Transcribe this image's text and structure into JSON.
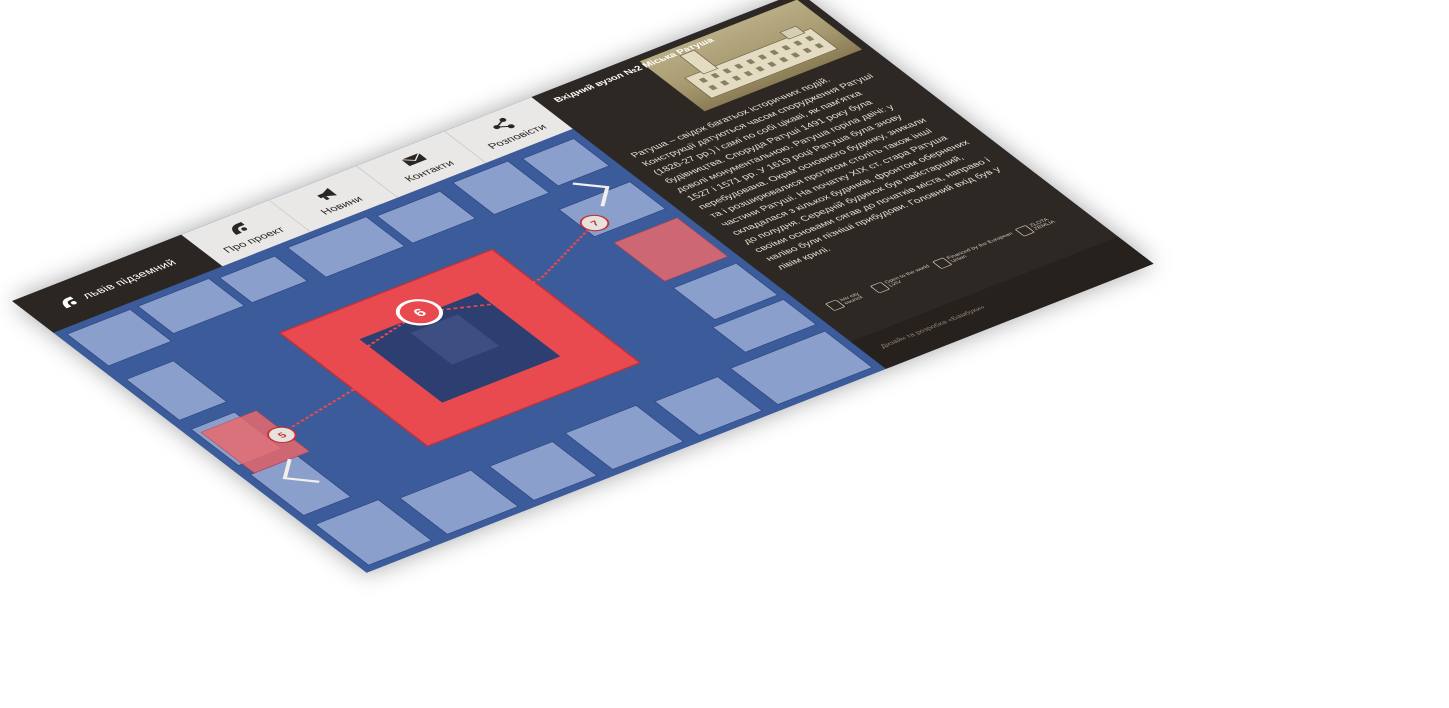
{
  "app": {
    "name": "львів підземний"
  },
  "nav": {
    "items": [
      {
        "label": "Про проект",
        "icon": "logo-mask-icon"
      },
      {
        "label": "Новини",
        "icon": "megaphone-icon"
      },
      {
        "label": "Контакти",
        "icon": "envelope-icon"
      },
      {
        "label": "Розповісти",
        "icon": "share-icon"
      }
    ]
  },
  "map": {
    "route_color": "#e84a4f",
    "building_highlight_color": "#e8585c",
    "markers": [
      {
        "number": "5"
      },
      {
        "number": "6"
      },
      {
        "number": "7"
      }
    ],
    "prev_arrow": "chevron-left-icon",
    "next_arrow": "chevron-right-icon"
  },
  "sidebar": {
    "title": "Вхідний вузол №2 Міська Ратуша",
    "paragraph": "Ратуша – свідок багатьох історичних подій. Конструкції датуються часом спорудження Ратуші (1826-27 рр.) і самі по собі цікаві, як пам'ятка будівництва. Споруда Ратуші 1491 року була доволі монументальною. Ратуша горіла двічі: у 1527 і 1571 рр. У 1619 році Ратуша була знову перебудована. Окрім основного будинку, зникали та і розширювалися протягом століть також інші частини Ратуші. На початку XIX ст. стара Ратуша складалася з кількох будинків, фронтом обернених до полудня. Середній будинок був найстарший, своїми основами сягав до початків міста, направо і наліво були пізніші прибудови. Головний вхід був у лівім крилі.",
    "partners": [
      {
        "label": "lviv city council"
      },
      {
        "label": "Open to the world LVIV"
      },
      {
        "label": "Financed by the European Union"
      },
      {
        "label": "ZLOTA ZEMLIA"
      }
    ],
    "credit": "Дизайн та розробка «Бамбуки»"
  }
}
